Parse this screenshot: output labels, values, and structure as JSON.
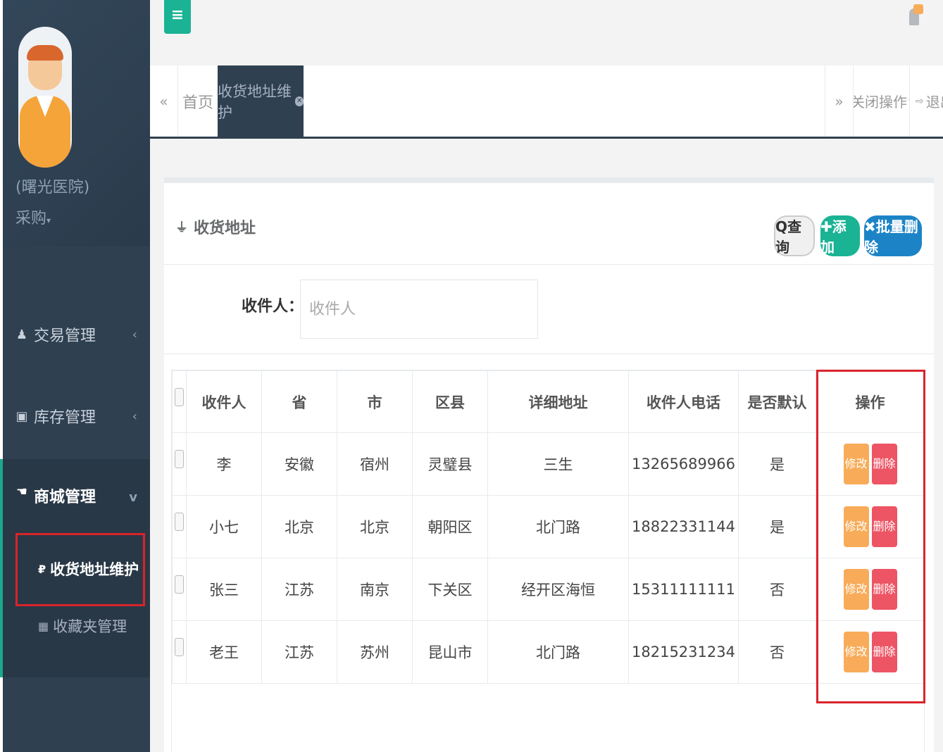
{
  "profile": {
    "org": "(曙光医院)",
    "role": "采购",
    "role_caret": "▾"
  },
  "sidebar": {
    "items": [
      {
        "label": "交易管理",
        "icon": "user-icon",
        "arrow": "‹"
      },
      {
        "label": "库存管理",
        "icon": "calendar-icon",
        "arrow": "‹"
      },
      {
        "label": "商城管理",
        "icon": "hand-icon",
        "arrow": "v"
      }
    ],
    "subitems": [
      {
        "label": "收货地址维护",
        "icon": "ruble-icon"
      },
      {
        "label": "收藏夹管理",
        "icon": "grid-icon"
      }
    ]
  },
  "header": {
    "menu_glyph": "≡"
  },
  "tabs": {
    "prev_glyph": "«",
    "home": "首页",
    "active": "收货地址维护",
    "next_glyph": "»",
    "close_ops": "关闭操作",
    "close_caret": "▾",
    "logout": "退出"
  },
  "panel": {
    "title": "收货地址",
    "buttons": {
      "query": "Q查询",
      "add": "✚添加",
      "batch_delete": "✖批量删除"
    }
  },
  "search": {
    "label": "收件人：",
    "placeholder": "收件人"
  },
  "table": {
    "headers": [
      "收件人",
      "省",
      "市",
      "区县",
      "详细地址",
      "收件人电话",
      "是否默认",
      "操作"
    ],
    "rows": [
      [
        "李",
        "安徽",
        "宿州",
        "灵璧县",
        "三生",
        "13265689966",
        "是"
      ],
      [
        "小七",
        "北京",
        "北京",
        "朝阳区",
        "北门路",
        "18822331144",
        "是"
      ],
      [
        "张三",
        "江苏",
        "南京",
        "下关区",
        "经开区海恒",
        "15311111111",
        "否"
      ],
      [
        "老王",
        "江苏",
        "苏州",
        "昆山市",
        "北门路",
        "18215231234",
        "否"
      ]
    ],
    "edit_label": "修改",
    "delete_label": "删除"
  },
  "colors": {
    "sidebar": "#2f4050",
    "primary": "#1ab394",
    "info": "#1c84c6",
    "warning": "#f8ac59",
    "danger": "#ed5565",
    "highlight": "#d9242b"
  }
}
